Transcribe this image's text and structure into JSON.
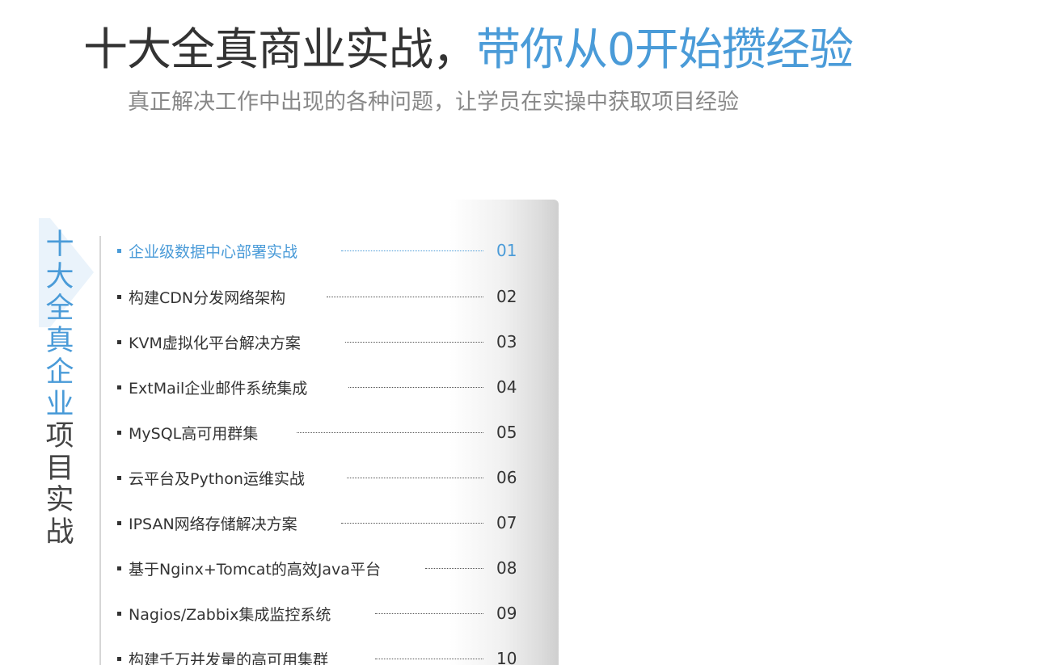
{
  "header": {
    "headline_part1": "十大全真商业实战，",
    "headline_part2": "带你从0开始攒经验",
    "subheadline": "真正解决工作中出现的各种问题，让学员在实操中获取项目经验"
  },
  "side_title": {
    "blue_chars": [
      "十",
      "大",
      "全",
      "真",
      "企",
      "业"
    ],
    "dark_chars": [
      "项",
      "目",
      "实",
      "战"
    ]
  },
  "projects": [
    {
      "label": "企业级数据中心部署实战",
      "number": "01",
      "active": true
    },
    {
      "label": "构建CDN分发网络架构",
      "number": "02"
    },
    {
      "label": "KVM虚拟化平台解决方案",
      "number": "03"
    },
    {
      "label": "ExtMail企业邮件系统集成",
      "number": "04"
    },
    {
      "label": "MySQL高可用群集",
      "number": "05"
    },
    {
      "label": "云平台及Python运维实战",
      "number": "06"
    },
    {
      "label": "IPSAN网络存储解决方案",
      "number": "07"
    },
    {
      "label": "基于Nginx+Tomcat的高效Java平台",
      "number": "08"
    },
    {
      "label": "Nagios/Zabbix集成监控系统",
      "number": "09"
    },
    {
      "label": "构建千万并发量的高可用集群",
      "number": "10"
    }
  ],
  "colors": {
    "accent": "#4a9bd8",
    "text_dark": "#333333",
    "text_muted": "#888888"
  }
}
